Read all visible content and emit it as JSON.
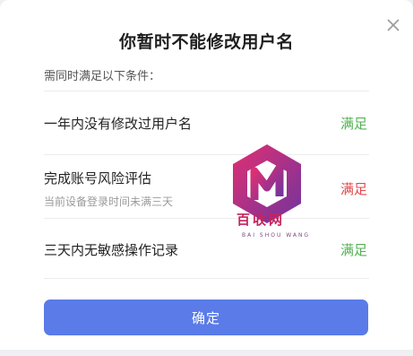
{
  "dialog": {
    "title": "你暂时不能修改用户名",
    "subtitle": "需同时满足以下条件：",
    "close_icon": "close-icon",
    "confirm_label": "确定"
  },
  "conditions": [
    {
      "title": "一年内没有修改过用户名",
      "detail": "",
      "status": "满足",
      "state": "ok"
    },
    {
      "title": "完成账号风险评估",
      "detail": "当前设备登录时间未满三天",
      "status": "满足",
      "state": "fail"
    },
    {
      "title": "三天内无敏感操作记录",
      "detail": "",
      "status": "满足",
      "state": "ok"
    }
  ],
  "watermark": {
    "icon": "logo-icon",
    "text": "百收网",
    "sub": "BAI SHOU WANG"
  },
  "colors": {
    "accent": "#5a7be8",
    "ok": "#52b152",
    "fail": "#e0484e"
  }
}
